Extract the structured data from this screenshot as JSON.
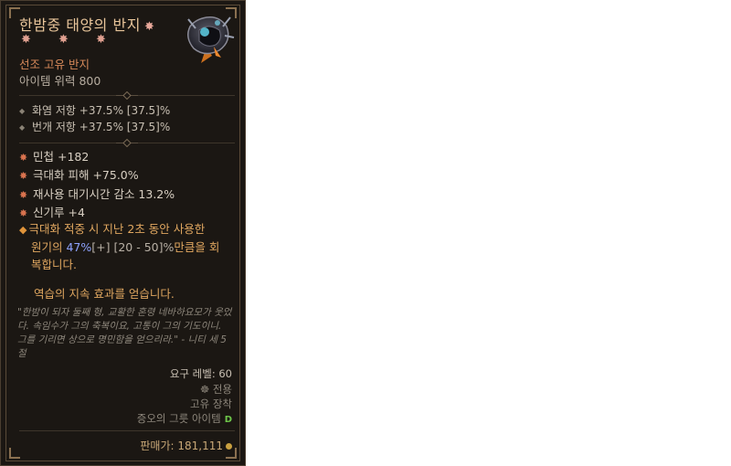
{
  "item": {
    "name": "한밤중 태양의 반지",
    "name_star": "✸",
    "rank_stars": "✸ ✸ ✸",
    "type": "선조 고유 반지",
    "power": "아이템 위력 800"
  },
  "resists": [
    "화염 저항 +37.5% [37.5]%",
    "번개 저항 +37.5% [37.5]%"
  ],
  "affixes": [
    "민첩 +182",
    "극대화 피해 +75.0%",
    "재사용 대기시간 감소 13.2%",
    "신기루 +4"
  ],
  "legendary": {
    "line1": "극대화 적중 시 지난 2초 동안 사용한",
    "line2_a": "원기의 ",
    "line2_value": "47%",
    "line2_b": "[+] [20 - 50]%",
    "line2_c": "만큼을 회",
    "line3": "복합니다."
  },
  "aspect": "역습의 지속 효과를 얻습니다.",
  "flavor": "\"한밤이 되자 둘째 형, 교활한 혼령 네바하요모가 웃었다. 속임수가 그의 축복이요, 고통이 그의 기도이니. 그를 기리면 상으로 명민함을 얻으리라.\" - 니티 세 5절",
  "requirements": {
    "level": "요구 레벨: 60",
    "class": "전용",
    "slot": "고유 장착",
    "tag": "증오의 그릇 아이템",
    "tag_badge": "D"
  },
  "sell": "판매가: 181,111",
  "colors": {
    "unique": "#e8c59a",
    "legendary": "#e0a760",
    "affix_bullet": "#d9734f",
    "value_blue": "#8ea3ff"
  },
  "icons": [
    "ring-item-icon",
    "class-icon",
    "coin-icon",
    "expansion-d-icon"
  ]
}
